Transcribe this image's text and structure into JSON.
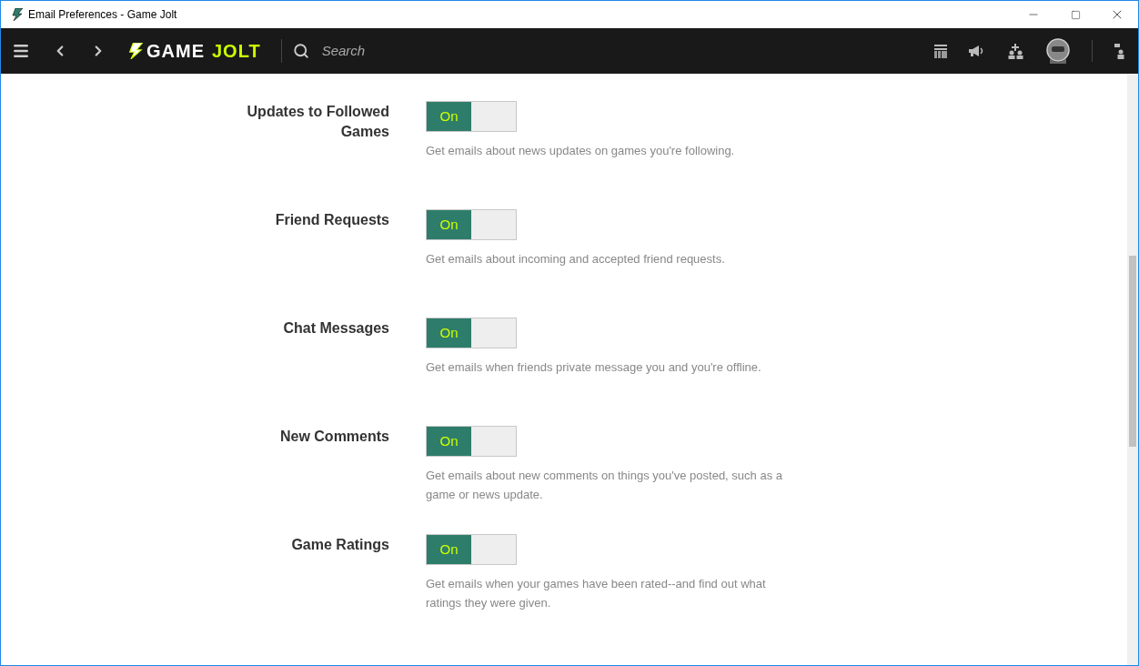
{
  "window": {
    "title": "Email Preferences - Game Jolt"
  },
  "nav": {
    "logo": [
      "GAME",
      "JOLT"
    ],
    "search": {
      "placeholder": "Search"
    }
  },
  "preferences": [
    {
      "label": "Updates to Followed Games",
      "on": true,
      "toggle_text": "On",
      "description": "Get emails about news updates on games you're following."
    },
    {
      "label": "Friend Requests",
      "on": true,
      "toggle_text": "On",
      "description": "Get emails about incoming and accepted friend requests."
    },
    {
      "label": "Chat Messages",
      "on": true,
      "toggle_text": "On",
      "description": "Get emails when friends private message you and you're offline."
    },
    {
      "label": "New Comments",
      "on": true,
      "toggle_text": "On",
      "description": "Get emails about new comments on things you've posted, such as a game or news update."
    },
    {
      "label": "Game Ratings",
      "on": true,
      "toggle_text": "On",
      "description": "Get emails when your games have been rated--and find out what ratings they were given."
    }
  ]
}
